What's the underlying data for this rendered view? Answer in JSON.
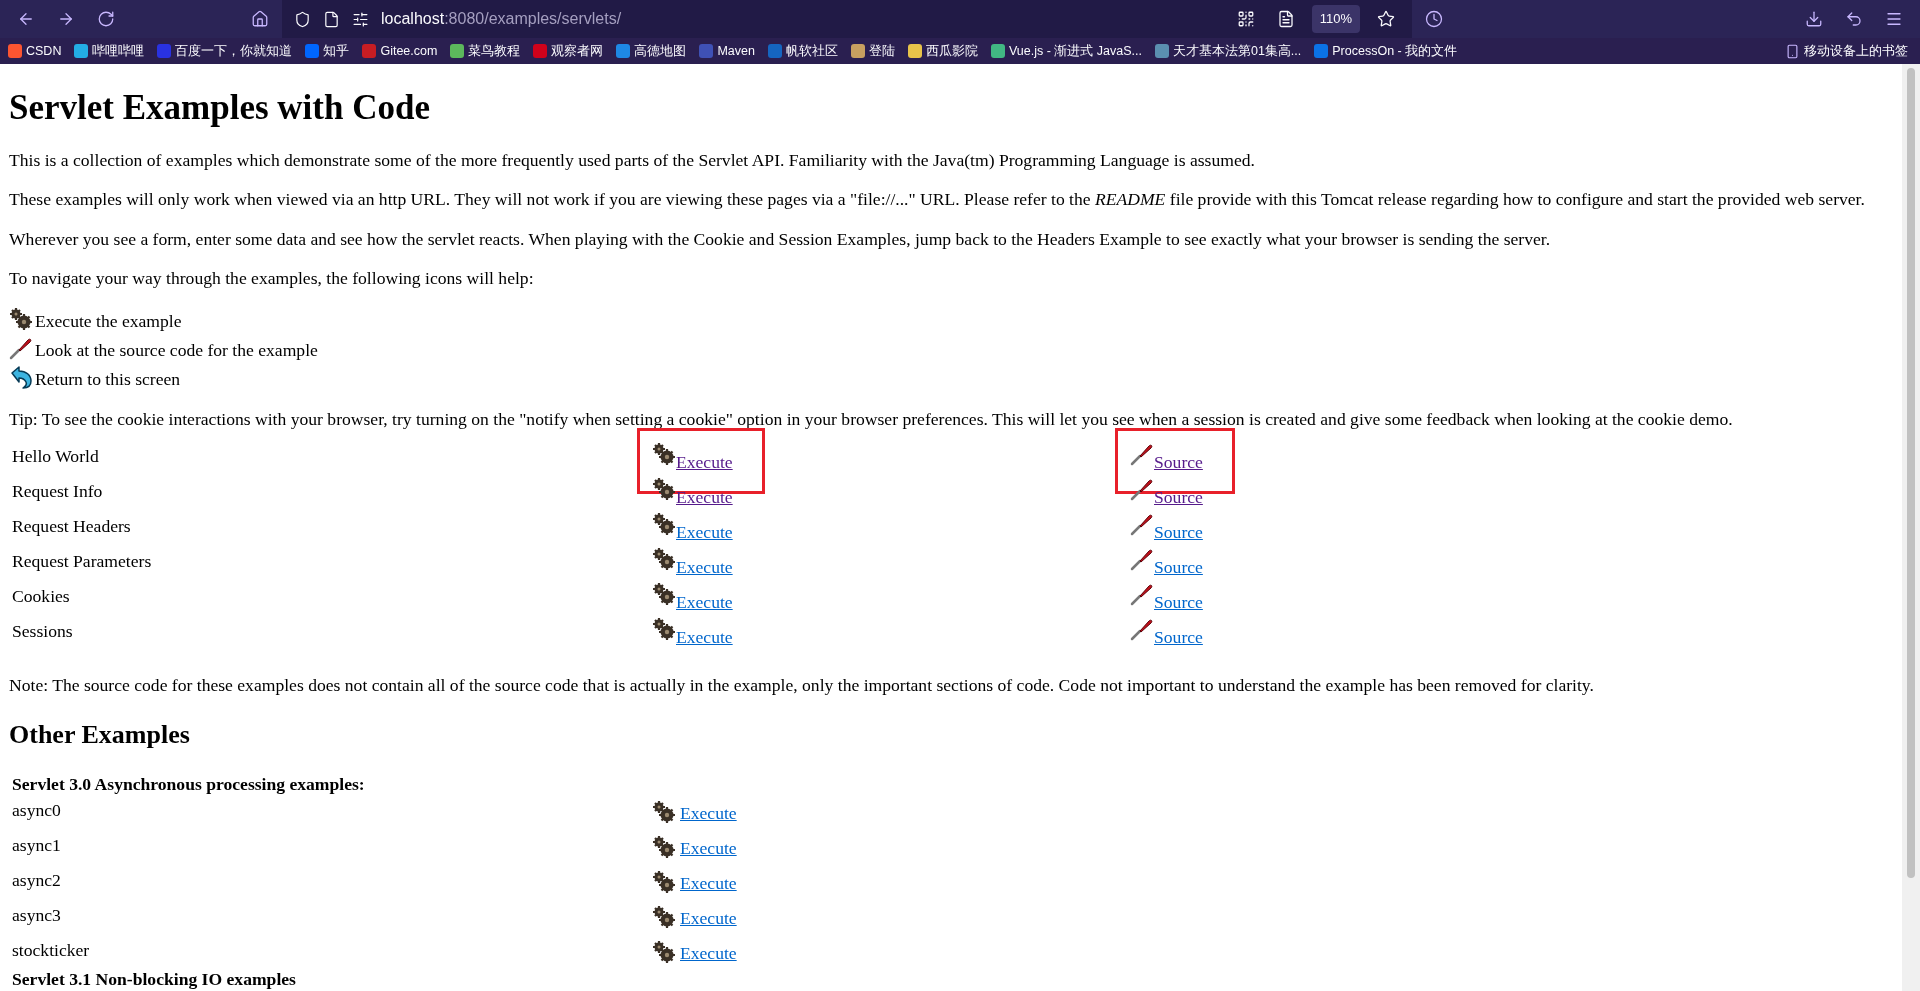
{
  "browser": {
    "url": {
      "host": "localhost",
      "rest": ":8080/examples/servlets/"
    },
    "zoom": "110%"
  },
  "bookmarks": [
    {
      "label": "CSDN",
      "color": "#fc5531"
    },
    {
      "label": "哔哩哔哩",
      "color": "#23ade5"
    },
    {
      "label": "百度一下，你就知道",
      "color": "#2932e1"
    },
    {
      "label": "知乎",
      "color": "#0066ff"
    },
    {
      "label": "Gitee.com",
      "color": "#c71d23"
    },
    {
      "label": "菜鸟教程",
      "color": "#5cb85c"
    },
    {
      "label": "观察者网",
      "color": "#d0021b"
    },
    {
      "label": "高德地图",
      "color": "#1e88e5"
    },
    {
      "label": "Maven",
      "color": "#3f51b5"
    },
    {
      "label": "帆软社区",
      "color": "#1565c0"
    },
    {
      "label": "登陆",
      "color": "#c8a060"
    },
    {
      "label": "西瓜影院",
      "color": "#e8c34a"
    },
    {
      "label": "Vue.js - 渐进式 JavaS...",
      "color": "#41b883"
    },
    {
      "label": "天才基本法第01集高...",
      "color": "#5b8fb0"
    },
    {
      "label": "ProcessOn - 我的文件",
      "color": "#0b72e7"
    }
  ],
  "mobile_bookmarks": "移动设备上的书签",
  "page": {
    "title": "Servlet Examples with Code",
    "paragraphs": [
      "This is a collection of examples which demonstrate some of the more frequently used parts of the Servlet API. Familiarity with the Java(tm) Programming Language is assumed.",
      "These examples will only work when viewed via an http URL. They will not work if you are viewing these pages via a \"file://...\" URL. Please refer to the *README* file provide with this Tomcat release regarding how to configure and start the provided web server.",
      "Wherever you see a form, enter some data and see how the servlet reacts. When playing with the Cookie and Session Examples, jump back to the Headers Example to see exactly what your browser is sending the server.",
      "To navigate your way through the examples, the following icons will help:"
    ],
    "legend": [
      {
        "kind": "execute",
        "label": "Execute the example"
      },
      {
        "kind": "source",
        "label": "Look at the source code for the example"
      },
      {
        "kind": "return",
        "label": "Return to this screen"
      }
    ],
    "tip": "Tip: To see the cookie interactions with your browser, try turning on the \"notify when setting a cookie\" option in your browser preferences. This will let you see when a session is created and give some feedback when looking at the cookie demo.",
    "examples": [
      {
        "name": "Hello World",
        "execute": {
          "label": "Execute",
          "visited": true,
          "highlighted": true
        },
        "source": {
          "label": "Source",
          "visited": true,
          "highlighted": true
        }
      },
      {
        "name": "Request Info",
        "execute": {
          "label": "Execute",
          "visited": true,
          "highlighted": false
        },
        "source": {
          "label": "Source",
          "visited": true,
          "highlighted": false
        }
      },
      {
        "name": "Request Headers",
        "execute": {
          "label": "Execute",
          "visited": false,
          "highlighted": false
        },
        "source": {
          "label": "Source",
          "visited": false,
          "highlighted": false
        }
      },
      {
        "name": "Request Parameters",
        "execute": {
          "label": "Execute",
          "visited": false,
          "highlighted": false
        },
        "source": {
          "label": "Source",
          "visited": false,
          "highlighted": false
        }
      },
      {
        "name": "Cookies",
        "execute": {
          "label": "Execute",
          "visited": false,
          "highlighted": false
        },
        "source": {
          "label": "Source",
          "visited": false,
          "highlighted": false
        }
      },
      {
        "name": "Sessions",
        "execute": {
          "label": "Execute",
          "visited": false,
          "highlighted": false
        },
        "source": {
          "label": "Source",
          "visited": false,
          "highlighted": false
        }
      }
    ],
    "note": "Note: The source code for these examples does not contain all of the source code that is actually in the example, only the important sections of code. Code not important to understand the example has been removed for clarity.",
    "other_heading": "Other Examples",
    "async_heading": "Servlet 3.0 Asynchronous processing examples:",
    "async_examples": [
      {
        "name": "async0",
        "execute": "Execute"
      },
      {
        "name": "async1",
        "execute": "Execute"
      },
      {
        "name": "async2",
        "execute": "Execute"
      },
      {
        "name": "async3",
        "execute": "Execute"
      },
      {
        "name": "stockticker",
        "execute": "Execute"
      }
    ],
    "next_heading": "Servlet 3.1 Non-blocking IO examples"
  }
}
